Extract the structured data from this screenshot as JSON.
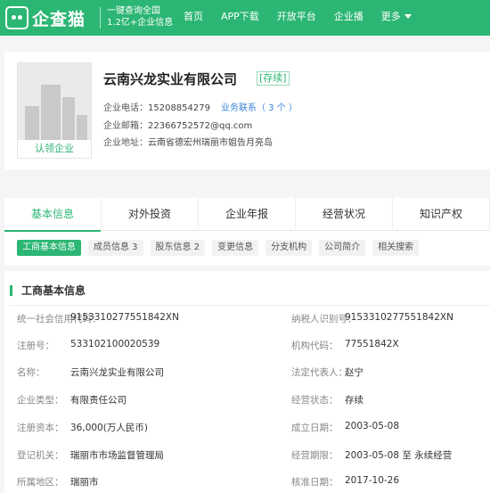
{
  "header": {
    "logo_text": "企查猫",
    "slogan_line1": "一键查询全国",
    "slogan_line2": "1.2亿+企业信息",
    "nav": [
      "首页",
      "APP下载",
      "开放平台",
      "企业播",
      "更多"
    ]
  },
  "company": {
    "name": "云南兴龙实业有限公司",
    "status_tag": "[存续]",
    "phone_label": "企业电话：",
    "phone": "15208854279",
    "biz_contact": "业务联系（ 3 个 ）",
    "email_label": "企业邮箱：",
    "email": "22366752572@qq.com",
    "address_label": "企业地址：",
    "address": "云南省德宏州瑞丽市姐告月亮岛",
    "claim": "认领企业"
  },
  "tabs": [
    "基本信息",
    "对外投资",
    "企业年报",
    "经营状况",
    "知识产权"
  ],
  "subtabs": [
    "工商基本信息",
    "成员信息 3",
    "股东信息 2",
    "变更信息",
    "分支机构",
    "公司简介",
    "相关搜索"
  ],
  "basic": {
    "title": "工商基本信息",
    "rows": [
      {
        "k1": "统一社会信用代码：",
        "v1": "915331027755184​2XN",
        "k2": "纳税人识别号：",
        "v2": "915331027755184​2XN"
      },
      {
        "k1": "注册号：",
        "v1": "533102100020539",
        "k2": "机构代码：",
        "v2": "77551842X"
      },
      {
        "k1": "名称：",
        "v1": "云南兴龙实业有限公司",
        "k2": "法定代表人：",
        "v2": "赵宁"
      },
      {
        "k1": "企业类型：",
        "v1": "有限责任公司",
        "k2": "经营状态：",
        "v2": "存续"
      },
      {
        "k1": "注册资本：",
        "v1": "36,000(万人民币)",
        "k2": "成立日期：",
        "v2": "2003-05-08"
      },
      {
        "k1": "登记机关：",
        "v1": "瑞丽市市场监督管理局",
        "k2": "经营期限：",
        "v2": "2003-05-08 至 永续经营"
      },
      {
        "k1": "所属地区：",
        "v1": "瑞丽市",
        "k2": "核准日期：",
        "v2": "2017-10-26"
      }
    ]
  },
  "colors": {
    "brand": "#2bb673",
    "link": "#3a86d6"
  }
}
